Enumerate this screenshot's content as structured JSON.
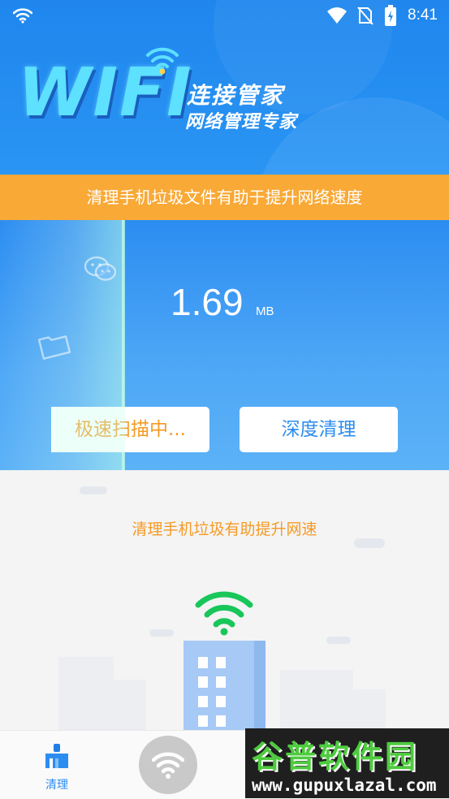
{
  "status_bar": {
    "time": "8:41"
  },
  "header": {
    "logo_wordmark": "WIFI",
    "title_line1": "连接管家",
    "title_line2": "网络管理专家"
  },
  "banner": {
    "text": "清理手机垃圾文件有助于提升网络速度"
  },
  "scan": {
    "size_value": "1.69",
    "size_unit": "MB",
    "progress_fraction": 0.28,
    "scan_button_label": "极速扫描中...",
    "deep_clean_button_label": "深度清理"
  },
  "lower": {
    "tip_text": "清理手机垃圾有助提升网速"
  },
  "tabbar": {
    "tabs": [
      {
        "label": "清理",
        "icon": "broom-icon",
        "active": true
      },
      {
        "label": "",
        "icon": "wifi-icon",
        "active": false
      }
    ]
  },
  "watermark": {
    "brand": "谷普软件园",
    "url": "www.gupuxlazal.com"
  },
  "colors": {
    "primary_blue": "#2c8df1",
    "banner_orange": "#f9a936",
    "accent_orange": "#f59a25",
    "wifi_green": "#19c65a"
  }
}
